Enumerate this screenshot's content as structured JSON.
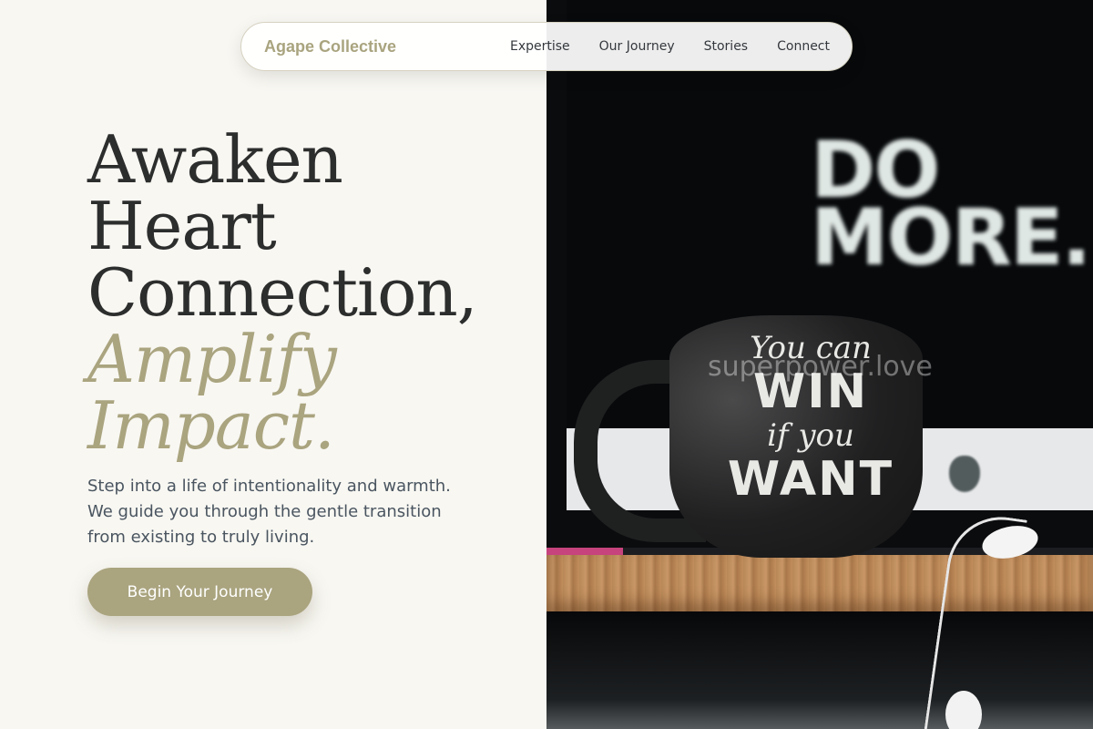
{
  "nav": {
    "brand": "Agape Collective",
    "links": [
      {
        "label": "Expertise"
      },
      {
        "label": "Our Journey"
      },
      {
        "label": "Stories"
      },
      {
        "label": "Connect"
      }
    ]
  },
  "hero": {
    "title_lines": [
      "Awaken",
      "Heart",
      "Connection,"
    ],
    "accent_lines": [
      "Amplify",
      "Impact."
    ],
    "description": "Step into a life of intentionality and warmth. We guide you through the gentle transition from existing to truly living.",
    "cta_label": "Begin Your Journey"
  },
  "image": {
    "screen_text": [
      "DO",
      "MORE."
    ],
    "mug_text": [
      "You can",
      "WIN",
      "if you",
      "WANT"
    ],
    "watermark": "superpower.love"
  },
  "colors": {
    "background": "#f8f7f2",
    "accent": "#aaa47f",
    "text": "#2c2d2d",
    "muted_text": "#4a5560"
  }
}
